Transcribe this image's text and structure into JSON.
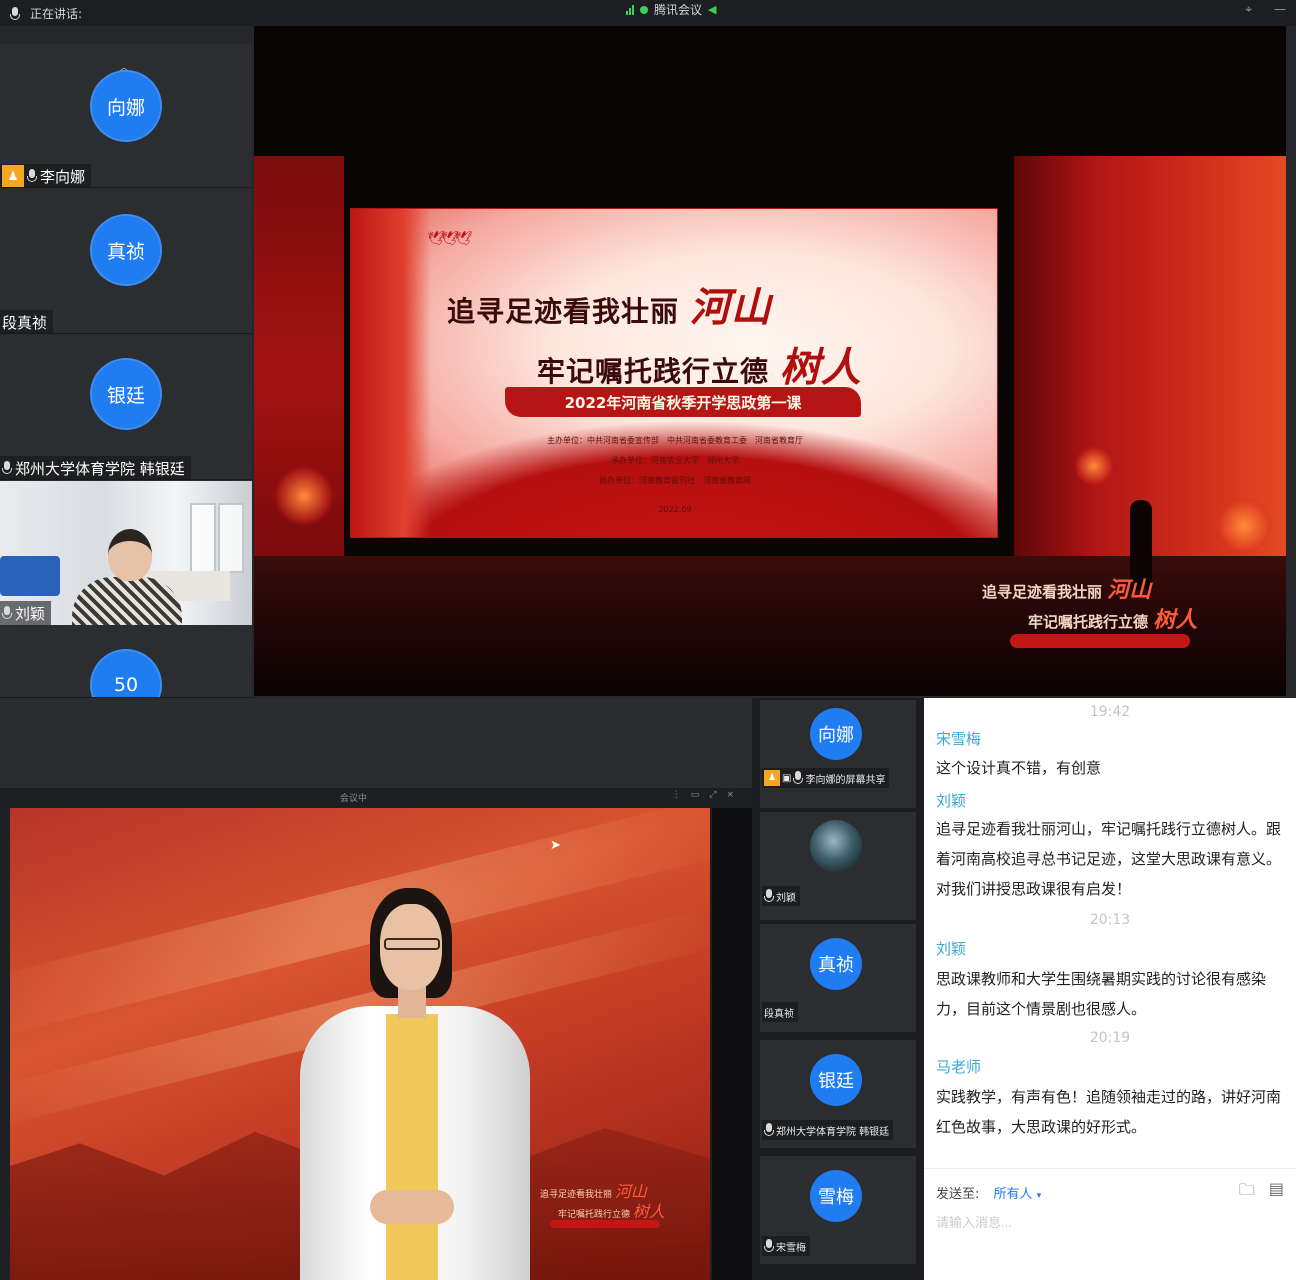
{
  "top": {
    "speaking_label": "正在讲话:",
    "app_title": "腾讯会议",
    "participants": [
      {
        "avatar": "向娜",
        "name": "李向娜",
        "host": true
      },
      {
        "avatar": "真祯",
        "name": "段真祯"
      },
      {
        "avatar": "银廷",
        "name": "郑州大学体育学院 韩银廷"
      },
      {
        "name": "刘颖",
        "video": true
      },
      {
        "avatar": "50"
      }
    ],
    "screen": {
      "line1_a": "追寻足迹看我壮丽",
      "line1_b": "河山",
      "line2_a": "牢记嘱托践行立德",
      "line2_b": "树人",
      "banner": "2022年河南省秋季开学思政第一课",
      "org1": "主办单位：中共河南省委宣传部　中共河南省委教育工委　河南省教育厅",
      "org2": "承办单位：河南农业大学　郑州大学",
      "org3": "协办单位：河南教育报刊社　河南省教育网",
      "date": "2022.09"
    },
    "caption": {
      "line1_a": "追寻足迹看我壮丽",
      "line1_b": "河山",
      "line2_a": "牢记嘱托践行立德",
      "line2_b": "树人"
    }
  },
  "lower": {
    "inner_title": "会议中",
    "participants": [
      {
        "avatar": "向娜",
        "name": "李向娜的屏幕共享",
        "host": true
      },
      {
        "photo": true,
        "name": "刘颖"
      },
      {
        "avatar": "真祯",
        "name": "段真祯"
      },
      {
        "avatar": "银廷",
        "name": "郑州大学体育学院 韩银廷"
      },
      {
        "avatar": "雪梅",
        "name": "宋雪梅"
      }
    ]
  },
  "chat": {
    "time1": "19:42",
    "msg1_name": "宋雪梅",
    "msg1_text": "这个设计真不错，有创意",
    "msg2_name": "刘颖",
    "msg2_text": "追寻足迹看我壮丽河山，牢记嘱托践行立德树人。跟着河南高校追寻总书记足迹，这堂大思政课有意义。对我们讲授思政课很有启发！",
    "time2": "20:13",
    "msg3_name": "刘颖",
    "msg3_text": "思政课教师和大学生围绕暑期实践的讨论很有感染力，目前这个情景剧也很感人。",
    "time3": "20:19",
    "msg4_name": "马老师",
    "msg4_text": "实践教学，有声有色！追随领袖走过的路，讲好河南红色故事，大思政课的好形式。",
    "send_to_label": "发送至:",
    "send_to_target": "所有人",
    "input_placeholder": "请输入消息..."
  },
  "colors": {
    "avatar_blue": "#1f7df1",
    "chat_name": "#3aa8d8",
    "host_badge": "#f5a623"
  }
}
